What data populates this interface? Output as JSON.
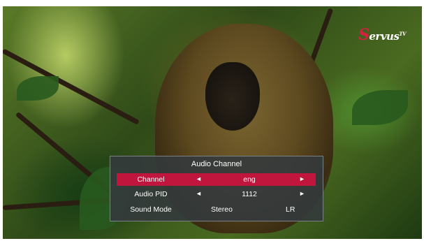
{
  "logo": {
    "initial": "S",
    "rest": "ervus",
    "suffix": "TV"
  },
  "osd": {
    "title": "Audio Channel",
    "rows": [
      {
        "label": "Channel",
        "left_arrow": "◄",
        "value": "eng",
        "right_arrow": "►"
      },
      {
        "label": "Audio PID",
        "left_arrow": "◄",
        "value": "1112",
        "right_arrow": "►"
      },
      {
        "label": "Sound Mode",
        "value": "Stereo",
        "value_secondary": "LR"
      }
    ],
    "selected_row": 0
  },
  "colors": {
    "highlight": "#c0163e",
    "panel": "#343a3c",
    "logo_accent": "#d4213d"
  }
}
